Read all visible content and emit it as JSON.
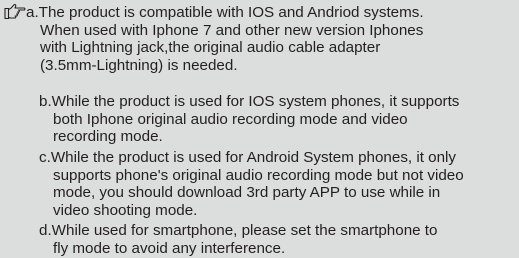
{
  "notes": [
    {
      "id": "a",
      "lines": [
        "a.The product is compatible with IOS and Andriod systems.",
        "When used with Iphone 7 and other new version Iphones",
        "with Lightning jack,the original audio cable adapter",
        "(3.5mm-Lightning) is needed."
      ]
    },
    {
      "id": "b",
      "lines": [
        "b.While the product is used for IOS system phones, it supports",
        "both Iphone original audio recording mode and video",
        "recording mode."
      ]
    },
    {
      "id": "c",
      "lines": [
        "c.While the product is used for Android System phones, it only",
        "supports phone's original audio recording mode but not video",
        "mode, you should download 3rd party APP to use while in",
        "video shooting mode."
      ]
    },
    {
      "id": "d",
      "lines": [
        "d.While used for smartphone, please set the smartphone to",
        "fly mode to avoid any interference."
      ]
    }
  ],
  "icons": {
    "note_marker": "pointing-hand-icon"
  }
}
